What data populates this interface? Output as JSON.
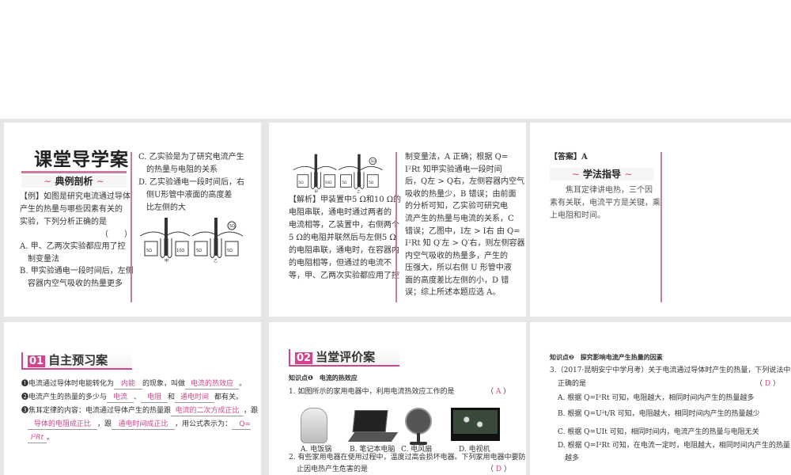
{
  "slide1": {
    "title": "课堂导学案",
    "banner": "典例剖析",
    "left_lines": [
      "【例】如图是研究电流通过导体",
      "产生的热量与哪些因素有关的",
      "实验，下列分析正确的是",
      "（　　）",
      "A. 甲、乙两次实验都应用了控",
      "　制变量法",
      "B. 甲实验通电一段时间后，左侧",
      "　容器内空气吸收的热量更多"
    ],
    "right_lines": [
      "C. 乙实验是为了研究电流产生",
      "　的热量与电阻的关系",
      "D. 乙实验通电一段时间后，右",
      "　侧U形管中液面的高度差",
      "　比左侧的大"
    ],
    "diagram_labels": [
      "5Ω",
      "10Ω",
      "5Ω",
      "5Ω",
      "5Ω",
      "甲",
      "乙"
    ]
  },
  "slide2": {
    "left_lines": [
      "【解析】甲装置中5 Ω和10 Ω的",
      "电阻串联，通电时通过两者的",
      "电流相等，乙装置中，右侧两个",
      "5 Ω的电阻并联然后与左侧5 Ω",
      "的电阻串联，通电时，在容器内",
      "的电阻相等，但通过的电流不",
      "等，甲、乙两次实验都应用了控"
    ],
    "right_lines": [
      "制变量法，A 正确；根据 Q=",
      "I²Rt 知甲实验通电一段时间",
      "后，Q左 > Q右，左侧容器内空气",
      "吸收的热量少，B 错误；由前面",
      "的分析可知，乙实验可研究电",
      "流产生的热量与电流的关系，C",
      "错误；乙图中，I左 > I右 由 Q=",
      "I²Rt 知 Q′左 > Q′右，则左侧容器",
      "内空气吸收的热量多，产生的",
      "压强大，所以右侧 U 形管中液",
      "面的高度差比左侧的小，D 错",
      "误；综上所述本题应选 A。"
    ],
    "diagram_labels": [
      "5Ω",
      "10Ω",
      "5Ω",
      "5Ω",
      "5Ω",
      "甲",
      "乙"
    ]
  },
  "slide3": {
    "answer": "【答案】A",
    "banner": "学法指导",
    "lines": [
      "　　焦耳定律讲电热，三个因",
      "素有关联，电流平方是关键，乘",
      "上电阻和时间。"
    ]
  },
  "slide4": {
    "num": "01",
    "title": "自主预习案",
    "q1": {
      "a": "❶电流通过导体时电能转化为",
      "b1": "内能",
      "c": "的现象，叫做",
      "b2": "电流的热效应",
      "d": "。"
    },
    "q2": {
      "a": "❷电流产生的热量的多少与",
      "b1": "电流",
      "s1": "、",
      "b2": "电阻",
      "s2": "和",
      "b3": "通电时间",
      "d": "都有关。"
    },
    "q3": {
      "a": "❸焦耳定律的内容：电流通过导体产生的热量跟",
      "b1": "电流的二次方成正比",
      "s1": "，跟",
      "b2": "导体的电阻成正比",
      "s2": "，跟",
      "b3": "通电时间成正比",
      "s3": "，用公式表示为：",
      "b4a": "Q=",
      "b4b": "I²Rt",
      "d": "。"
    }
  },
  "slide5": {
    "num": "02",
    "title": "当堂评价案",
    "kp": "知识点❶　电流的热效应",
    "q1": "1. 如图所示的家用电器中，利用电流热效应工作的是",
    "q1_answer": "A",
    "options": [
      "A. 电饭锅",
      "B. 笔记本电脑",
      "C. 电风扇",
      "D. 电视机"
    ],
    "q2a": "2. 有些家用电器在使用过程中，温度过高会损坏电器。下列家用电器中要防",
    "q2b": "止因电热产生危害的是",
    "q2_answer": "D"
  },
  "slide6": {
    "kp": "知识点❷　探究影响电流产生热量的因素",
    "q3a": "3.（2017·昆明安宁中学月考）关于电流通过导体时产生的热量，下列说法中",
    "q3b": "正确的是",
    "q3_answer": "D",
    "options": [
      "A. 根据 Q=I²Rt 可知，电阻越大，相同时间内产生的热量越多",
      "B. 根据 Q=U²t/R 可知，电阻越大，相同时间内产生的热量越少",
      "C. 根据 Q=UIt 可知，相同时间内，电流产生的热量与电阻无关",
      "D. 根据 Q=I²Rt 可知，在电流一定时，电阻越大，相同时间内产生的热量",
      "　越多"
    ]
  }
}
